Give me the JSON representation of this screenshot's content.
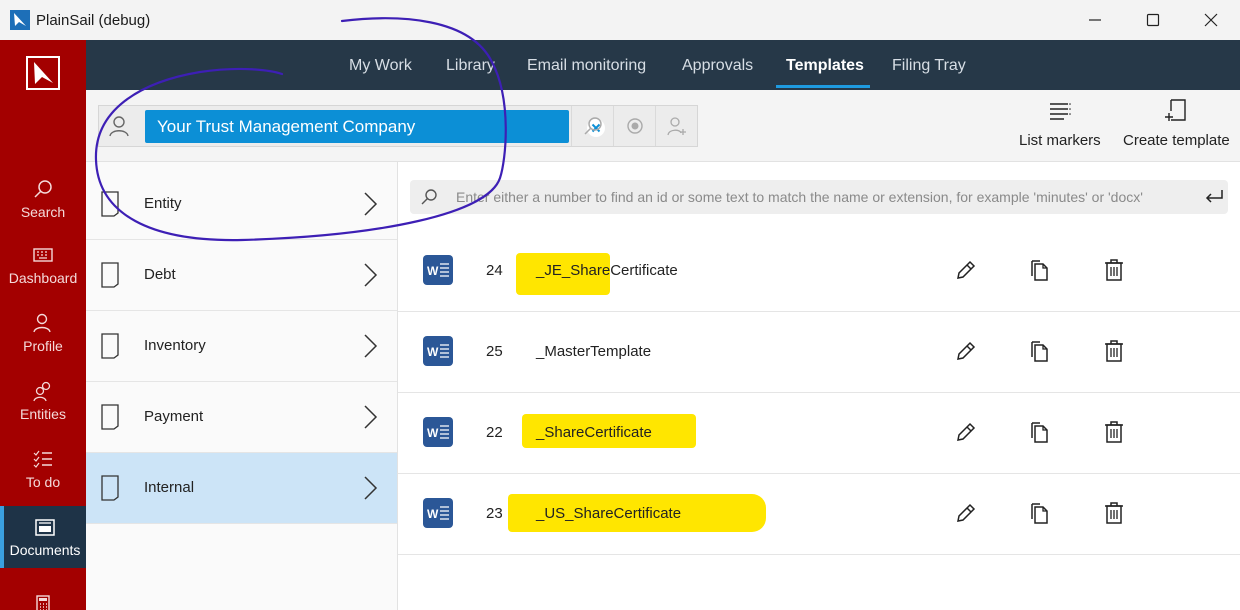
{
  "window": {
    "title": "PlainSail (debug)"
  },
  "rail": {
    "items": [
      {
        "label": "Search",
        "icon": "search-icon"
      },
      {
        "label": "Dashboard",
        "icon": "keyboard-icon"
      },
      {
        "label": "Profile",
        "icon": "person-icon"
      },
      {
        "label": "Entities",
        "icon": "people-icon"
      },
      {
        "label": "To do",
        "icon": "checklist-icon"
      },
      {
        "label": "Documents",
        "icon": "documents-icon"
      }
    ],
    "active": "Documents"
  },
  "topnav": {
    "tabs": [
      "My Work",
      "Library",
      "Email monitoring",
      "Approvals",
      "Templates",
      "Filing Tray"
    ],
    "active": "Templates"
  },
  "toolbar": {
    "entity": "Your Trust Management Company",
    "list_markers": "List markers",
    "create_template": "Create template"
  },
  "categories": [
    {
      "label": "Entity"
    },
    {
      "label": "Debt"
    },
    {
      "label": "Inventory"
    },
    {
      "label": "Payment"
    },
    {
      "label": "Internal"
    }
  ],
  "filter": {
    "placeholder": "Enter either a number to find an id or some text to match the name or extension, for example 'minutes' or 'docx'"
  },
  "templates": [
    {
      "id": "24",
      "name": "_JE_ShareCertificate"
    },
    {
      "id": "25",
      "name": "_MasterTemplate"
    },
    {
      "id": "22",
      "name": "_ShareCertificate"
    },
    {
      "id": "23",
      "name": "_US_ShareCertificate"
    }
  ],
  "colors": {
    "rail": "#a30000",
    "nav": "#263848",
    "accent": "#1e9be0",
    "highlight": "#ffe600",
    "annotation": "#3d1fb5"
  }
}
